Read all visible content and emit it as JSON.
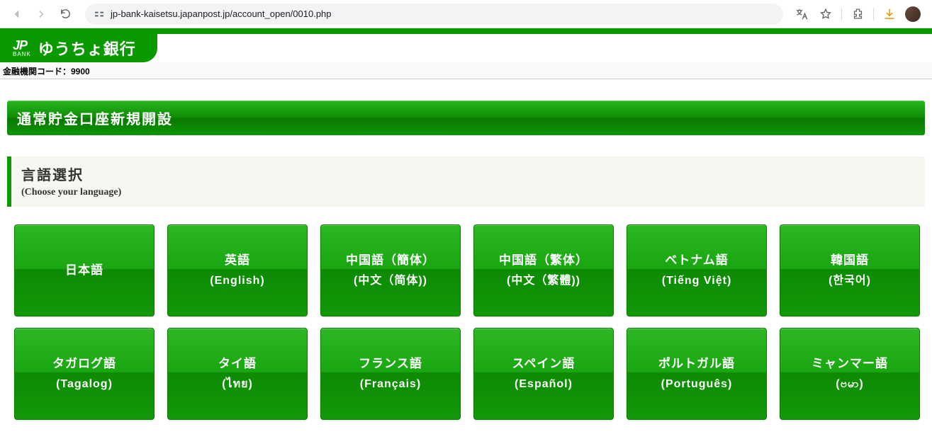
{
  "browser": {
    "url": "jp-bank-kaisetsu.japanpost.jp/account_open/0010.php"
  },
  "header": {
    "logo_jp": "JP",
    "logo_bank": "BANK",
    "bank_name": "ゆうちょ銀行",
    "inst_code": "金融機関コード：9900"
  },
  "page": {
    "title": "通常貯金口座新規開設",
    "section_title": "言語選択",
    "section_sub": "(Choose your language)"
  },
  "languages": [
    {
      "jp": "日本語",
      "native": ""
    },
    {
      "jp": "英語",
      "native": "(English)"
    },
    {
      "jp": "中国語（簡体）",
      "native": "(中文（简体))"
    },
    {
      "jp": "中国語（繁体）",
      "native": "(中文（繁體))"
    },
    {
      "jp": "ベトナム語",
      "native": "(Tiếng Việt)"
    },
    {
      "jp": "韓国語",
      "native": "(한국어)"
    },
    {
      "jp": "タガログ語",
      "native": "(Tagalog)"
    },
    {
      "jp": "タイ語",
      "native": "(ไทย)"
    },
    {
      "jp": "フランス語",
      "native": "(Français)"
    },
    {
      "jp": "スペイン語",
      "native": "(Español)"
    },
    {
      "jp": "ポルトガル語",
      "native": "(Português)"
    },
    {
      "jp": "ミャンマー語",
      "native": "(ဗမာ)"
    }
  ]
}
